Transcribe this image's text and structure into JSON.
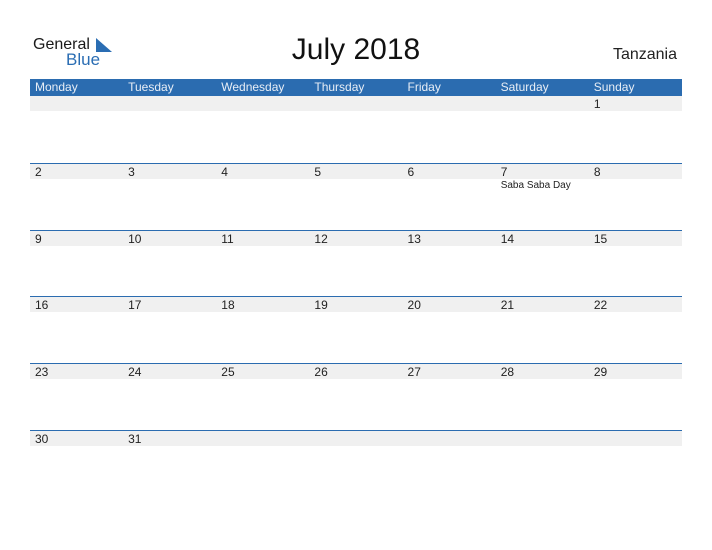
{
  "logo": {
    "general": "General",
    "blue": "Blue"
  },
  "title": "July 2018",
  "country": "Tanzania",
  "colors": {
    "header": "#2b6cb0",
    "band": "#f0f0f0",
    "logo_blue": "#2a6db3"
  },
  "weekdays": [
    "Monday",
    "Tuesday",
    "Wednesday",
    "Thursday",
    "Friday",
    "Saturday",
    "Sunday"
  ],
  "weeks": [
    [
      "",
      "",
      "",
      "",
      "",
      "",
      "1"
    ],
    [
      "2",
      "3",
      "4",
      "5",
      "6",
      "7",
      "8"
    ],
    [
      "9",
      "10",
      "11",
      "12",
      "13",
      "14",
      "15"
    ],
    [
      "16",
      "17",
      "18",
      "19",
      "20",
      "21",
      "22"
    ],
    [
      "23",
      "24",
      "25",
      "26",
      "27",
      "28",
      "29"
    ],
    [
      "30",
      "31",
      "",
      "",
      "",
      "",
      ""
    ]
  ],
  "events": [
    {
      "week": 1,
      "day": 5,
      "label": "Saba Saba Day"
    }
  ]
}
